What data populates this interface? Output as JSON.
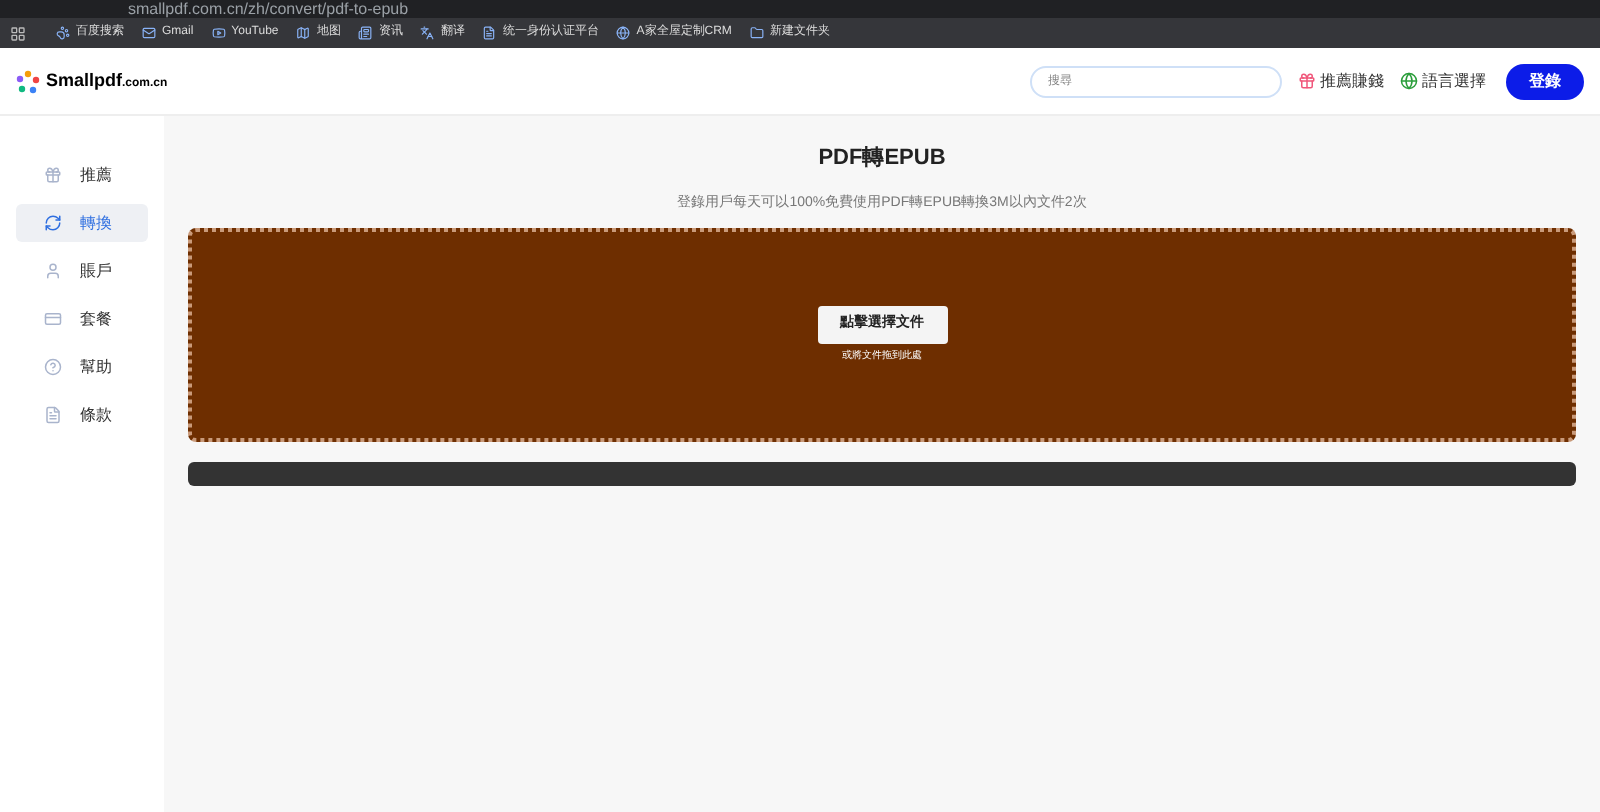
{
  "browser": {
    "address": "smallpdf.com.cn/zh/convert/pdf-to-epub",
    "bookmarks": [
      {
        "label": "百度搜索",
        "kind": "paw"
      },
      {
        "label": "Gmail",
        "kind": "mail"
      },
      {
        "label": "YouTube",
        "kind": "video"
      },
      {
        "label": "地图",
        "kind": "map"
      },
      {
        "label": "资讯",
        "kind": "news"
      },
      {
        "label": "翻译",
        "kind": "translate"
      },
      {
        "label": "统一身份认证平台",
        "kind": "page"
      },
      {
        "label": "A家全屋定制CRM",
        "kind": "globe"
      },
      {
        "label": "新建文件夹",
        "kind": "folder"
      }
    ]
  },
  "header": {
    "logo": "Smallpdf",
    "logo_suffix": ".com.cn",
    "search": {
      "placeholder": "搜尋"
    },
    "referral": "推薦賺錢",
    "language": "語言選擇",
    "login": "登錄"
  },
  "sidebar": {
    "items": [
      {
        "label": "推薦",
        "kind": "gift",
        "selected": false
      },
      {
        "label": "轉換",
        "kind": "convert",
        "selected": true
      },
      {
        "label": "賬戶",
        "kind": "user",
        "selected": false
      },
      {
        "label": "套餐",
        "kind": "card",
        "selected": false
      },
      {
        "label": "幫助",
        "kind": "help",
        "selected": false
      },
      {
        "label": "條款",
        "kind": "doc",
        "selected": false
      }
    ]
  },
  "main": {
    "title": "PDF轉EPUB",
    "subtitle": "登錄用戶每天可以100%免費使用PDF轉EPUB轉換3M以內文件2次",
    "upload_button": "點擊選擇文件",
    "drop_hint": "或將文件拖到此處"
  }
}
